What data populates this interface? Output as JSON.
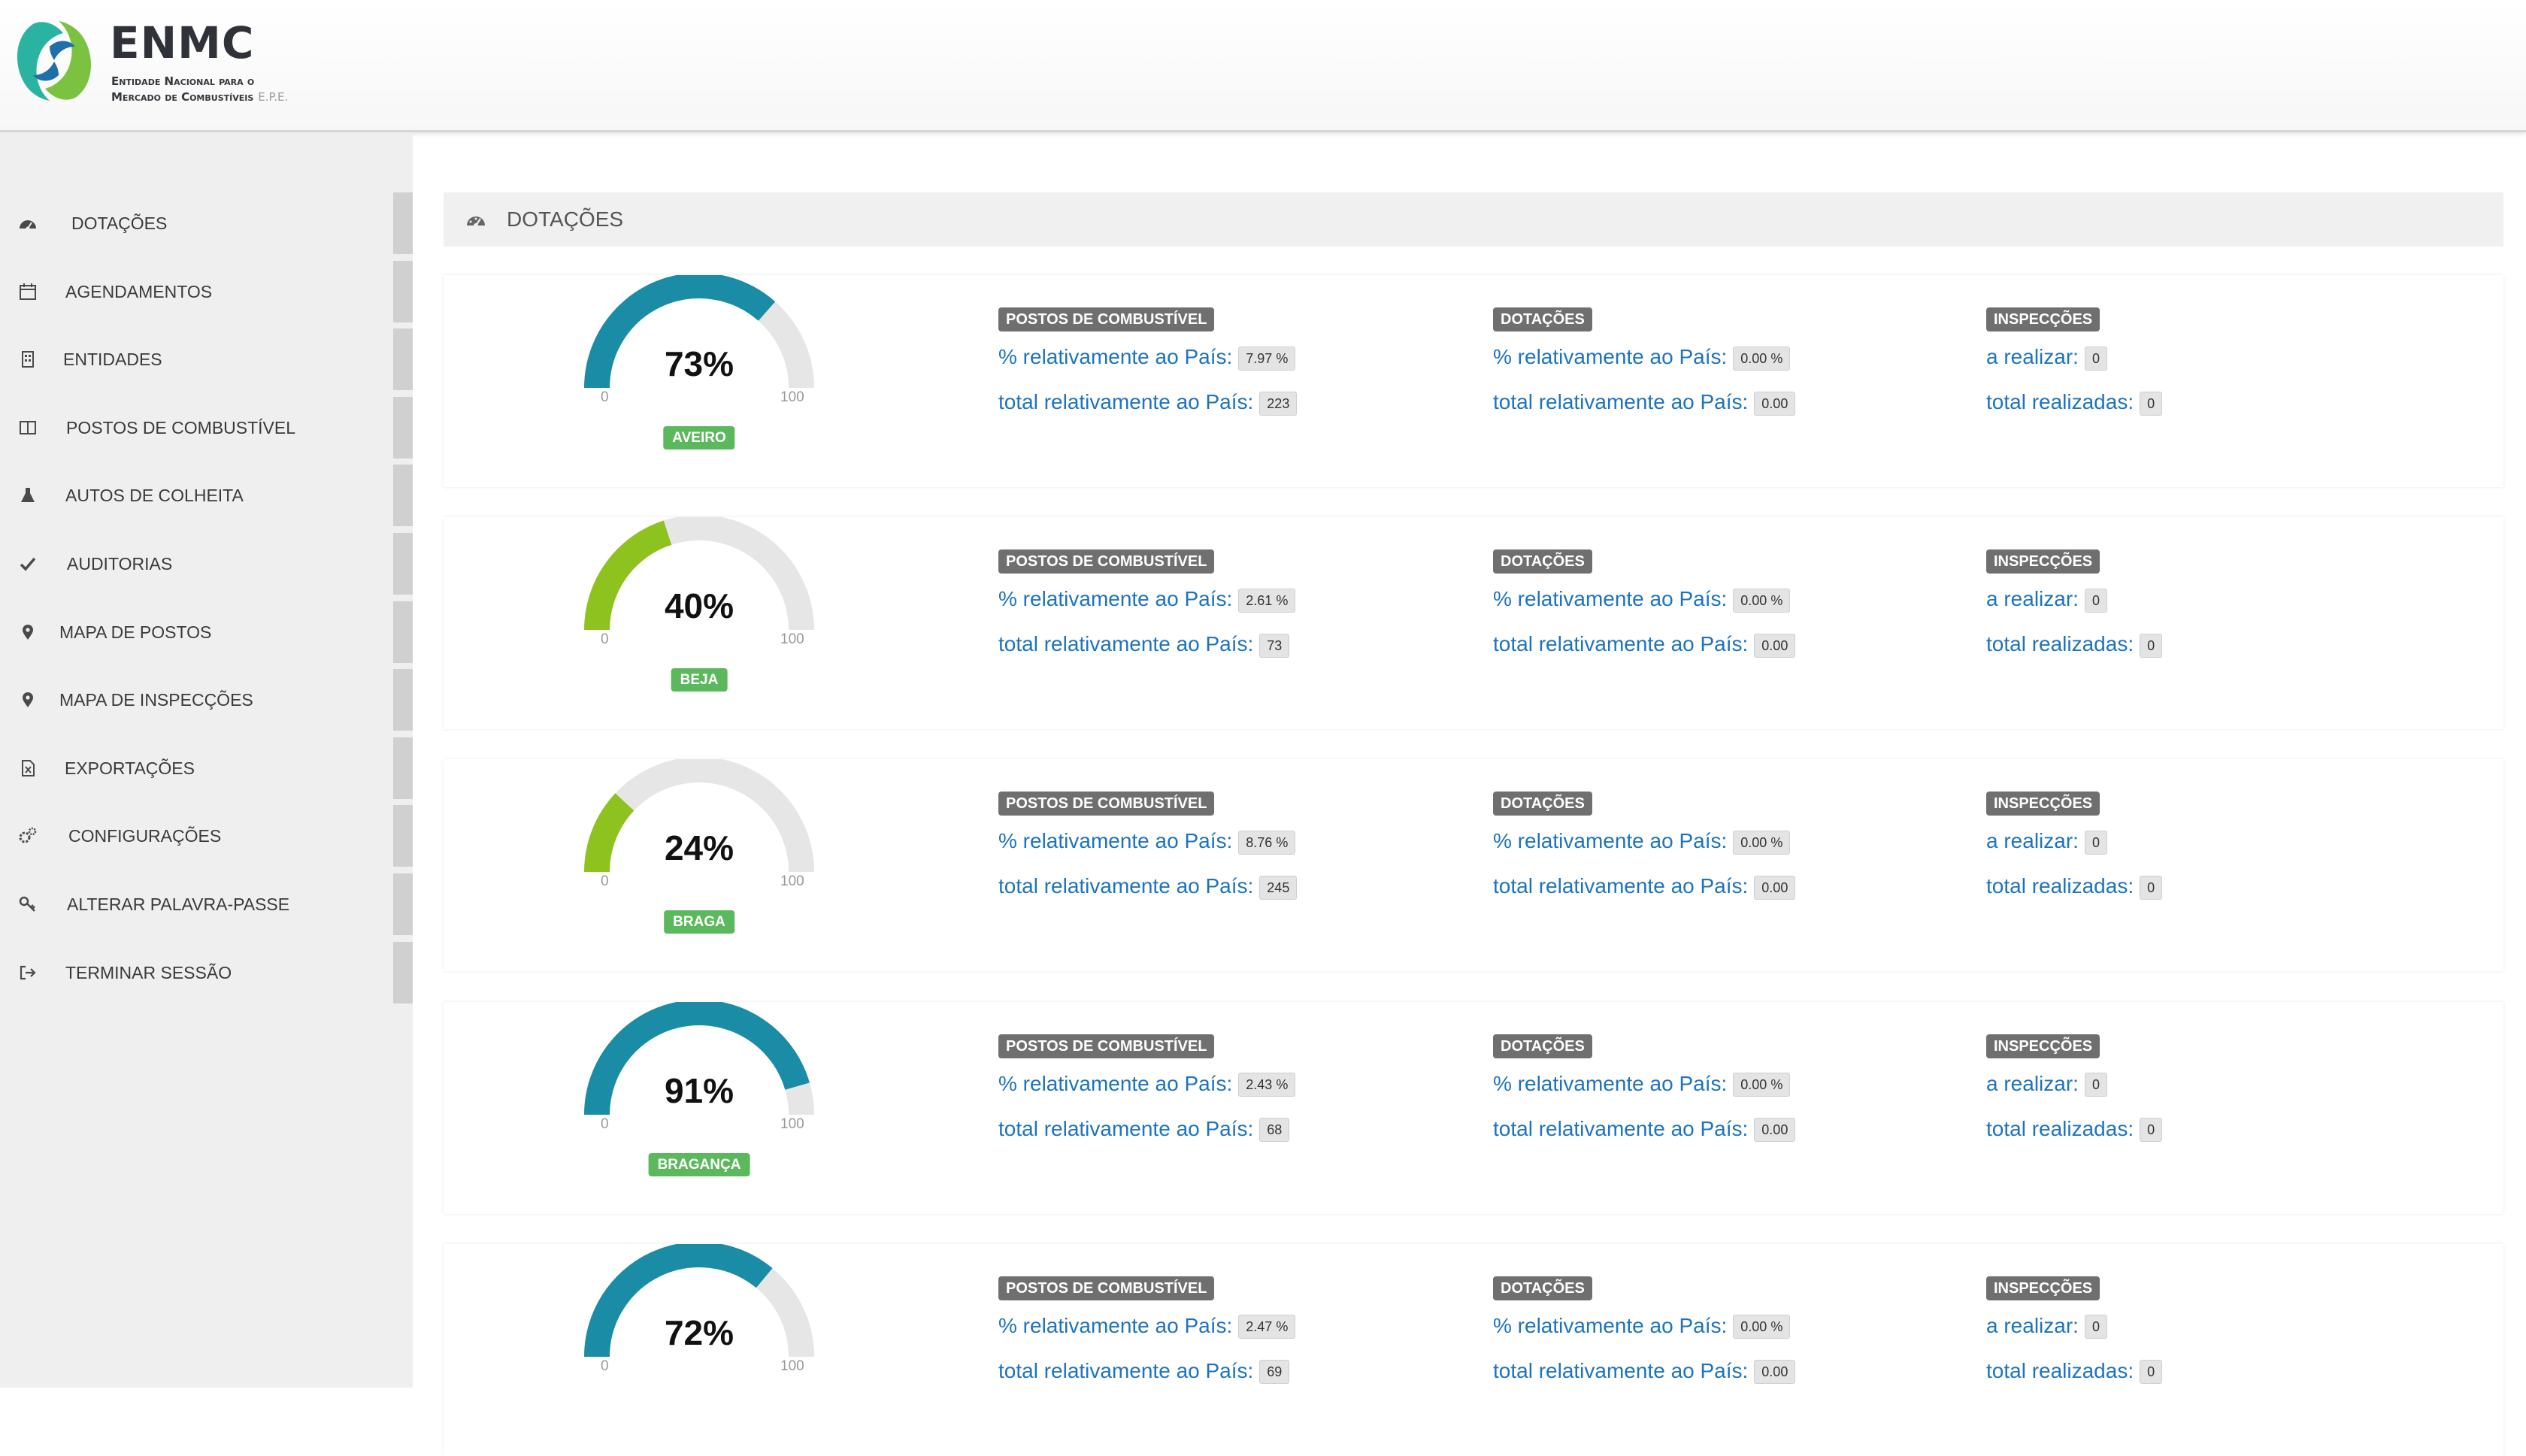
{
  "header": {
    "title": "ENMC",
    "subtitle_line1": "Entidade Nacional para o",
    "subtitle_line2": "Mercado de Combustíveis",
    "subtitle_suffix": "E.P.E."
  },
  "sidebar": {
    "items": [
      {
        "label": "Dotações",
        "icon": "dashboard-icon"
      },
      {
        "label": "Agendamentos",
        "icon": "calendar-icon"
      },
      {
        "label": "Entidades",
        "icon": "building-icon"
      },
      {
        "label": "Postos de Combustível",
        "icon": "columns-icon"
      },
      {
        "label": "Autos de Colheita",
        "icon": "flask-icon"
      },
      {
        "label": "Auditorias",
        "icon": "check-icon"
      },
      {
        "label": "Mapa de Postos",
        "icon": "map-marker-icon"
      },
      {
        "label": "Mapa de Inspecções",
        "icon": "map-marker-icon"
      },
      {
        "label": "Exportações",
        "icon": "file-excel-icon"
      },
      {
        "label": "Configurações",
        "icon": "gears-icon"
      },
      {
        "label": "Alterar Palavra-Passe",
        "icon": "key-icon"
      },
      {
        "label": "Terminar Sessão",
        "icon": "sign-out-icon"
      }
    ]
  },
  "page": {
    "title": "Dotações"
  },
  "labels": {
    "postos": "Postos de Combustível",
    "dotacoes": "Dotações",
    "inspeccoes": "Inspecções",
    "pct_pais": "% relativamente ao País:",
    "total_pais": "total relativamente ao País:",
    "a_realizar": "a realizar:",
    "total_realizadas": "total realizadas:",
    "gauge_min": "0",
    "gauge_max": "100"
  },
  "colors": {
    "gauge_teal": "#1a8ca6",
    "gauge_green": "#8ec21f",
    "gauge_track": "#e6e6e6",
    "region_badge": "#5cb85c"
  },
  "cards": [
    {
      "region": "Aveiro",
      "percent": 73,
      "percent_label": "73%",
      "color": "teal",
      "postos": {
        "pct": "7.97 %",
        "total": "223"
      },
      "dotacoes": {
        "pct": "0.00 %",
        "total": "0.00"
      },
      "inspeccoes": {
        "a_realizar": "0",
        "total_realizadas": "0"
      }
    },
    {
      "region": "Beja",
      "percent": 40,
      "percent_label": "40%",
      "color": "green",
      "postos": {
        "pct": "2.61 %",
        "total": "73"
      },
      "dotacoes": {
        "pct": "0.00 %",
        "total": "0.00"
      },
      "inspeccoes": {
        "a_realizar": "0",
        "total_realizadas": "0"
      }
    },
    {
      "region": "Braga",
      "percent": 24,
      "percent_label": "24%",
      "color": "green",
      "postos": {
        "pct": "8.76 %",
        "total": "245"
      },
      "dotacoes": {
        "pct": "0.00 %",
        "total": "0.00"
      },
      "inspeccoes": {
        "a_realizar": "0",
        "total_realizadas": "0"
      }
    },
    {
      "region": "Bragança",
      "percent": 91,
      "percent_label": "91%",
      "color": "teal",
      "postos": {
        "pct": "2.43 %",
        "total": "68"
      },
      "dotacoes": {
        "pct": "0.00 %",
        "total": "0.00"
      },
      "inspeccoes": {
        "a_realizar": "0",
        "total_realizadas": "0"
      }
    },
    {
      "region": "",
      "percent": 72,
      "percent_label": "72%",
      "color": "teal",
      "postos": {
        "pct": "2.47 %",
        "total": "69"
      },
      "dotacoes": {
        "pct": "0.00 %",
        "total": "0.00"
      },
      "inspeccoes": {
        "a_realizar": "0",
        "total_realizadas": "0"
      }
    }
  ]
}
